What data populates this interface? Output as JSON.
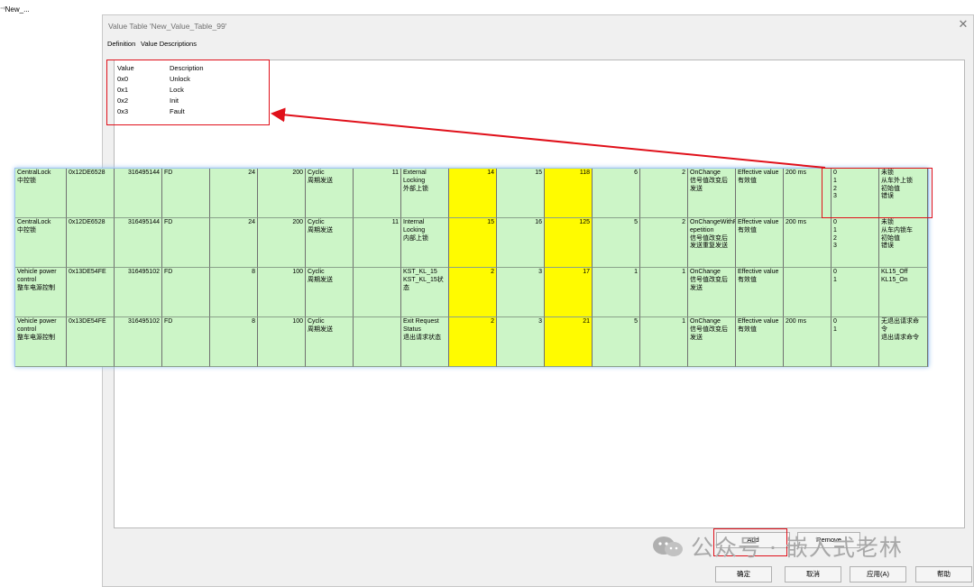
{
  "tree": {
    "item_label": "New_..."
  },
  "dialog": {
    "title": "Value Table 'New_Value_Table_99'",
    "tabs": [
      "Definition",
      "Value Descriptions"
    ],
    "value_table": {
      "headers": [
        "Value",
        "Description"
      ],
      "rows": [
        [
          "0x0",
          "Unlock"
        ],
        [
          "0x1",
          "Lock"
        ],
        [
          "0x2",
          "Init"
        ],
        [
          "0x3",
          "Fault"
        ]
      ]
    },
    "buttons": {
      "add": "Add",
      "remove": "Remove",
      "ok": "确定",
      "cancel": "取消",
      "apply": "应用(A)",
      "help": "帮助"
    }
  },
  "overlay_table": {
    "rows": [
      {
        "name": [
          "CentralLock",
          "中控锁"
        ],
        "id": "0x12DE6528",
        "dec": "316495144",
        "type": "FD",
        "dlc": "24",
        "cycle": "200",
        "send": [
          "Cyclic",
          "周期发送"
        ],
        "start": "11",
        "signal": [
          "External Locking",
          "外部上锁"
        ],
        "s1": "14",
        "s2": "15",
        "s3": "118",
        "s4": "6",
        "s5": "2",
        "change": [
          "OnChange",
          "信号值改变后",
          "发送"
        ],
        "effective": [
          "Effective value",
          "有效值"
        ],
        "timeout": "200 ms",
        "vals": [
          "0",
          "1",
          "2",
          "3"
        ],
        "descs": [
          "未锁",
          "从车外上锁",
          "初始值",
          "错误"
        ]
      },
      {
        "name": [
          "CentralLock",
          "中控锁"
        ],
        "id": "0x12DE6528",
        "dec": "316495144",
        "type": "FD",
        "dlc": "24",
        "cycle": "200",
        "send": [
          "Cyclic",
          "周期发送"
        ],
        "start": "11",
        "signal": [
          "Internal Locking",
          "内部上锁"
        ],
        "s1": "15",
        "s2": "16",
        "s3": "125",
        "s4": "5",
        "s5": "2",
        "change": [
          "OnChangeWithR",
          "epetition",
          "信号值改变后",
          "发送重复发送"
        ],
        "effective": [
          "Effective value",
          "有效值"
        ],
        "timeout": "200 ms",
        "vals": [
          "0",
          "1",
          "2",
          "3"
        ],
        "descs": [
          "未锁",
          "从车内锁车",
          "初始值",
          "错误"
        ]
      },
      {
        "name": [
          "Vehicle power",
          "control",
          "整车电源控制"
        ],
        "id": "0x13DE54FE",
        "dec": "316495102",
        "type": "FD",
        "dlc": "8",
        "cycle": "100",
        "send": [
          "Cyclic",
          "周期发送"
        ],
        "start": "",
        "signal": [
          "KST_KL_15",
          "KST_KL_15状",
          "态"
        ],
        "s1": "2",
        "s2": "3",
        "s3": "17",
        "s4": "1",
        "s5": "1",
        "change": [
          "OnChange",
          "信号值改变后",
          "发送"
        ],
        "effective": [
          "Effective value",
          "有效值"
        ],
        "timeout": "",
        "vals": [
          "0",
          "1"
        ],
        "descs": [
          "KL15_Off",
          "KL15_On"
        ]
      },
      {
        "name": [
          "Vehicle power",
          "control",
          "整车电源控制"
        ],
        "id": "0x13DE54FE",
        "dec": "316495102",
        "type": "FD",
        "dlc": "8",
        "cycle": "100",
        "send": [
          "Cyclic",
          "周期发送"
        ],
        "start": "",
        "signal": [
          "Exit Request",
          "Status",
          "退出请求状态"
        ],
        "s1": "2",
        "s2": "3",
        "s3": "21",
        "s4": "5",
        "s5": "1",
        "change": [
          "OnChange",
          "信号值改变后",
          "发送"
        ],
        "effective": [
          "Effective value",
          "有效值"
        ],
        "timeout": "200 ms",
        "vals": [
          "0",
          "1"
        ],
        "descs": [
          "无退出请求命",
          "令",
          "退出请求命令"
        ]
      }
    ]
  },
  "watermark": {
    "text": "公众号 · 嵌入式老林"
  },
  "colors": {
    "overlay_bg": "#ccf5c7",
    "highlight": "#fffb00",
    "annotation": "#e0101a"
  }
}
